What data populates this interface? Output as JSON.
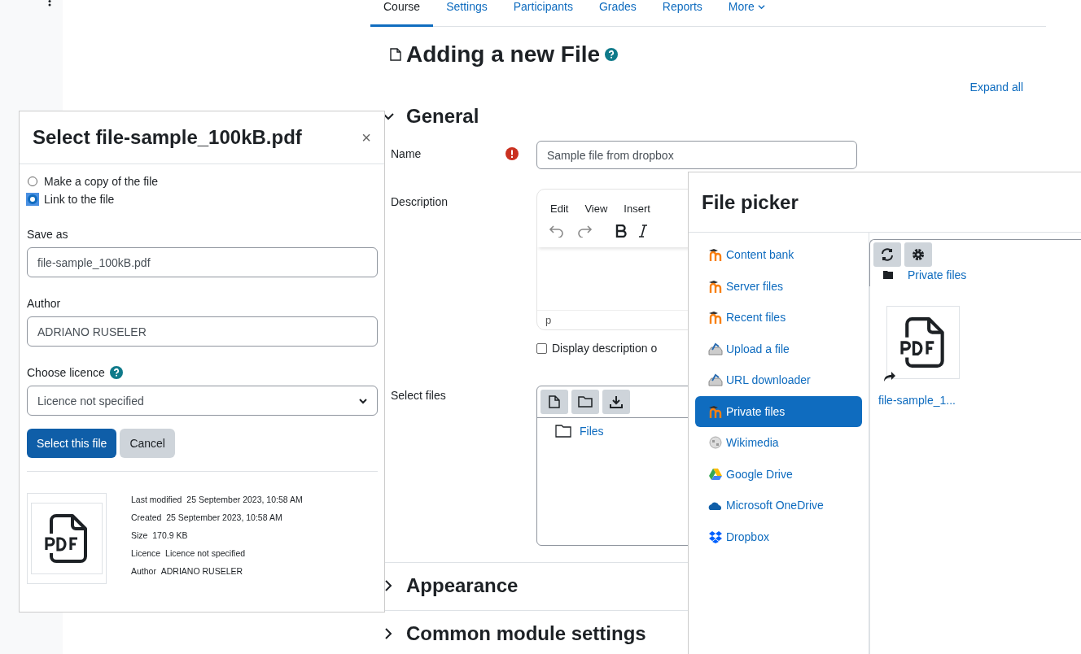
{
  "nav_tabs": [
    {
      "label": "Course",
      "selected": true
    },
    {
      "label": "Settings",
      "selected": false
    },
    {
      "label": "Participants",
      "selected": false
    },
    {
      "label": "Grades",
      "selected": false
    },
    {
      "label": "Reports",
      "selected": false
    },
    {
      "label": "More",
      "selected": false,
      "dropdown": true
    }
  ],
  "page": {
    "title": "Adding a new File",
    "expand_all": "Expand all"
  },
  "sections": [
    {
      "title": "General",
      "expanded": true
    },
    {
      "title": "Appearance",
      "expanded": false
    },
    {
      "title": "Common module settings",
      "expanded": false
    }
  ],
  "name_field": {
    "label": "Name",
    "required": true,
    "value": "Sample file from dropbox"
  },
  "description": {
    "label": "Description",
    "menu": [
      "Edit",
      "View",
      "Insert"
    ],
    "status": "p",
    "display_option": {
      "label": "Display description o",
      "checked": false
    }
  },
  "select_files": {
    "label": "Select files",
    "tree": [
      "Files"
    ]
  },
  "select_file_dialog": {
    "title": "Select file-sample_100kB.pdf",
    "close": "×",
    "options": [
      {
        "label": "Make a copy of the file",
        "selected": false
      },
      {
        "label": "Link to the file",
        "selected": true
      }
    ],
    "save_as": {
      "label": "Save as",
      "value": "file-sample_100kB.pdf"
    },
    "author": {
      "label": "Author",
      "value": "ADRIANO RUSELER"
    },
    "licence": {
      "label": "Choose licence",
      "value": "Licence not specified"
    },
    "buttons": [
      {
        "label": "Select this file",
        "kind": "primary"
      },
      {
        "label": "Cancel",
        "kind": "secondary"
      }
    ],
    "details": [
      {
        "label": "Last modified",
        "value": "25 September 2023, 10:58 AM"
      },
      {
        "label": "Created",
        "value": "25 September 2023, 10:58 AM"
      },
      {
        "label": "Size",
        "value": "170.9 KB"
      },
      {
        "label": "Licence",
        "value": "Licence not specified"
      },
      {
        "label": "Author",
        "value": "ADRIANO RUSELER"
      }
    ]
  },
  "file_picker": {
    "title": "File picker",
    "repositories": [
      {
        "label": "Content bank",
        "kind": "moodle",
        "selected": false
      },
      {
        "label": "Server files",
        "kind": "moodle",
        "selected": false
      },
      {
        "label": "Recent files",
        "kind": "moodle",
        "selected": false
      },
      {
        "label": "Upload a file",
        "kind": "upload",
        "selected": false
      },
      {
        "label": "URL downloader",
        "kind": "upload",
        "selected": false
      },
      {
        "label": "Private files",
        "kind": "moodle",
        "selected": true
      },
      {
        "label": "Wikimedia",
        "kind": "wikimedia",
        "selected": false
      },
      {
        "label": "Google Drive",
        "kind": "gdrive",
        "selected": false
      },
      {
        "label": "Microsoft OneDrive",
        "kind": "onedrive",
        "selected": false
      },
      {
        "label": "Dropbox",
        "kind": "dropbox",
        "selected": false
      }
    ],
    "path": "Private files",
    "files": [
      {
        "name": "file-sample_1...",
        "linked": true
      }
    ]
  }
}
